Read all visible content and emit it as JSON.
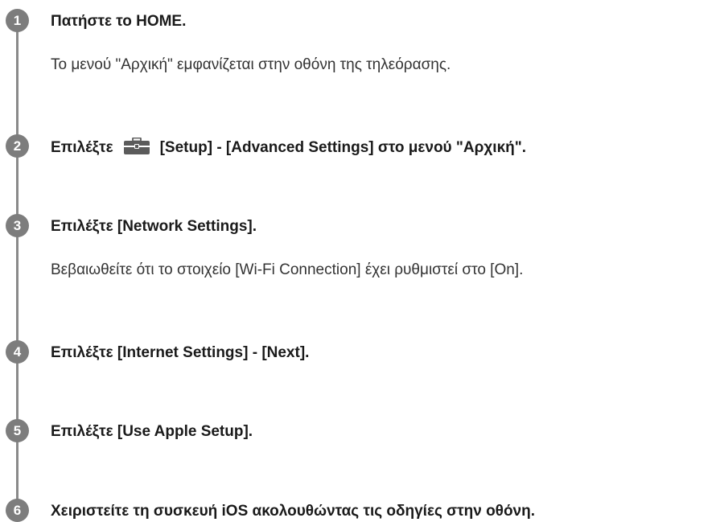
{
  "steps": [
    {
      "number": "1",
      "title": "Πατήστε το HOME.",
      "description": "Το μενού \"Αρχική\" εμφανίζεται στην οθόνη της τηλεόρασης."
    },
    {
      "number": "2",
      "title_before_icon": "Επιλέξτε",
      "icon": "toolbox-icon",
      "title_after_icon": "[Setup] - [Advanced Settings] στο μενού \"Αρχική\"."
    },
    {
      "number": "3",
      "title": "Επιλέξτε [Network Settings].",
      "description": "Βεβαιωθείτε ότι το στοιχείο [Wi-Fi Connection] έχει ρυθμιστεί στο [On]."
    },
    {
      "number": "4",
      "title": "Επιλέξτε [Internet Settings] - [Next]."
    },
    {
      "number": "5",
      "title": "Επιλέξτε [Use Apple Setup]."
    },
    {
      "number": "6",
      "title": "Χειριστείτε τη συσκευή iOS ακολουθώντας τις οδηγίες στην οθόνη."
    }
  ],
  "colors": {
    "step_badge": "#7d7d7d",
    "timeline": "#8a8a8a",
    "text": "#1a1a1a",
    "toolbox_body": "#5b5b5b"
  }
}
